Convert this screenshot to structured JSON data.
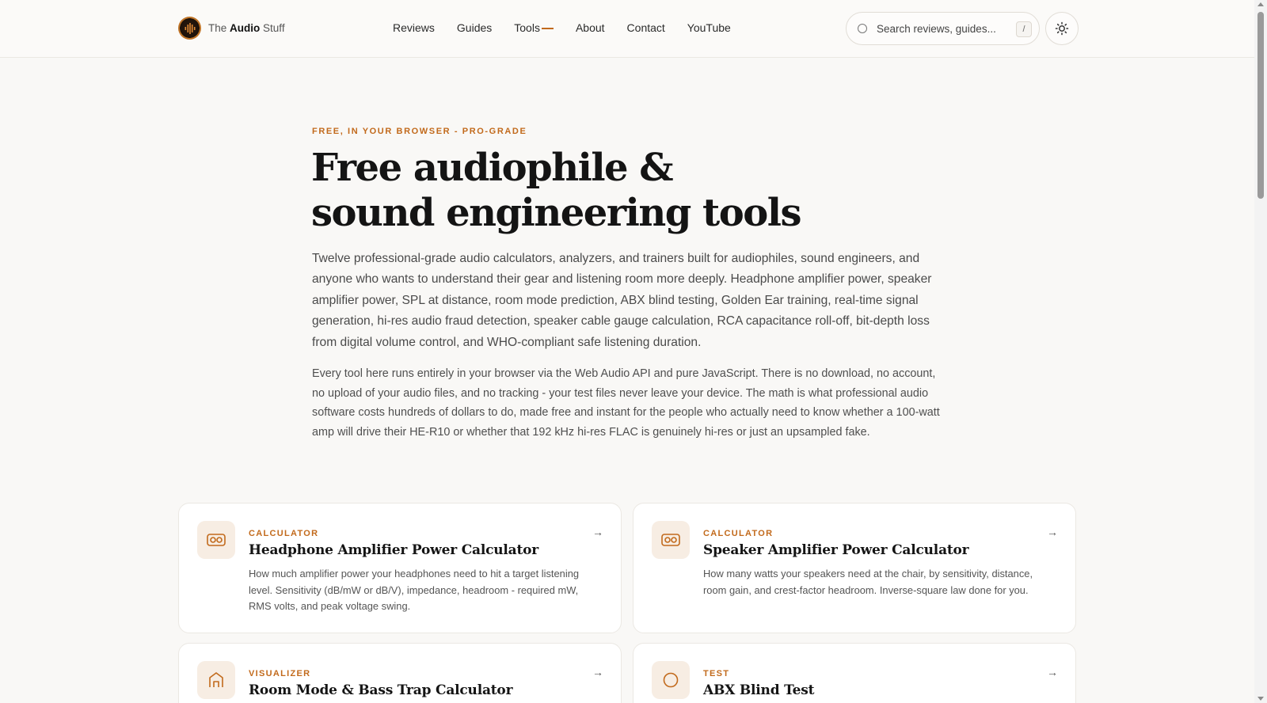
{
  "brand": {
    "prefix": "The",
    "bold": "Audio",
    "suffix": "Stuff"
  },
  "nav": {
    "items": [
      {
        "label": "Reviews"
      },
      {
        "label": "Guides"
      },
      {
        "label": "Tools"
      },
      {
        "label": "About"
      },
      {
        "label": "Contact"
      },
      {
        "label": "YouTube"
      }
    ],
    "active_item": "Tools"
  },
  "search": {
    "placeholder": "Search reviews, guides...",
    "shortcut": "/"
  },
  "theme_toggle": {
    "icon": "sun-icon"
  },
  "colors": {
    "accent": "#c26a1c",
    "background": "#f9f8f6",
    "card_icon_bg": "#f7ede3"
  },
  "hero": {
    "eyebrow": "FREE, IN YOUR BROWSER - PRO-GRADE",
    "title_line1": "Free audiophile &",
    "title_line2": "sound engineering tools",
    "lead": "Twelve professional-grade audio calculators, analyzers, and trainers built for audiophiles, sound engineers, and anyone who wants to understand their gear and listening room more deeply. Headphone amplifier power, speaker amplifier power, SPL at distance, room mode prediction, ABX blind testing, Golden Ear training, real-time signal generation, hi-res audio fraud detection, speaker cable gauge calculation, RCA capacitance roll-off, bit-depth loss from digital volume control, and WHO-compliant safe listening duration.",
    "sub": "Every tool here runs entirely in your browser via the Web Audio API and pure JavaScript. There is no download, no account, no upload of your audio files, and no tracking - your test files never leave your device. The math is what professional audio software costs hundreds of dollars to do, made free and instant for the people who actually need to know whether a 100-watt amp will drive their HE-R10 or whether that 192 kHz hi-res FLAC is genuinely hi-res or just an upsampled fake."
  },
  "tools": [
    {
      "category": "CALCULATOR",
      "title": "Headphone Amplifier Power Calculator",
      "description": "How much amplifier power your headphones need to hit a target listening level. Sensitivity (dB/mW or dB/V), impedance, headroom - required mW, RMS volts, and peak voltage swing.",
      "icon": "amplifier-icon",
      "arrow": "→"
    },
    {
      "category": "CALCULATOR",
      "title": "Speaker Amplifier Power Calculator",
      "description": "How many watts your speakers need at the chair, by sensitivity, distance, room gain, and crest-factor headroom. Inverse-square law done for you.",
      "icon": "amplifier-icon",
      "arrow": "→"
    },
    {
      "category": "VISUALIZER",
      "title": "Room Mode & Bass Trap Calculator",
      "description": "",
      "icon": "room-icon",
      "arrow": "→"
    },
    {
      "category": "TEST",
      "title": "ABX Blind Test",
      "description": "",
      "icon": "circle-icon",
      "arrow": "→"
    }
  ]
}
